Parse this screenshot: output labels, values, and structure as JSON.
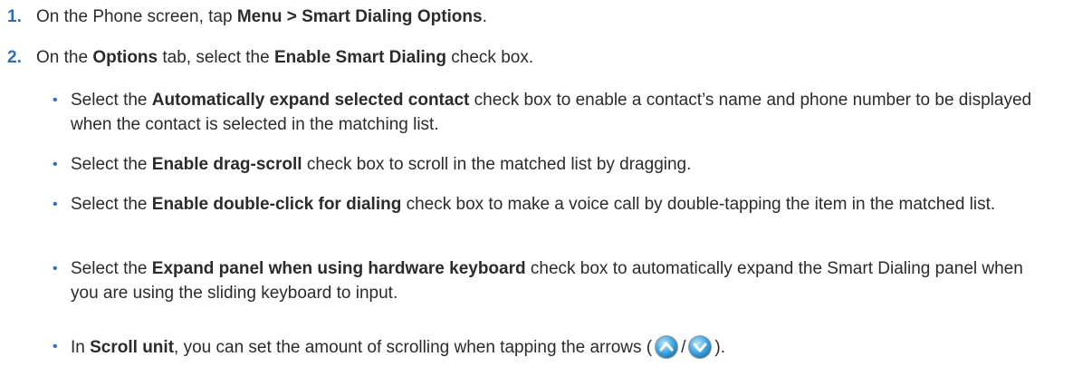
{
  "steps": [
    {
      "number": "1.",
      "pre": "On the Phone screen, tap ",
      "bold": "Menu > Smart Dialing Options",
      "post": "."
    },
    {
      "number": "2.",
      "pre": "On the ",
      "bold1": "Options",
      "mid": " tab, select the ",
      "bold2": "Enable Smart Dialing",
      "post": " check box."
    }
  ],
  "bullets": [
    {
      "pre": "Select the ",
      "bold": "Automatically expand selected contact",
      "post": " check box to enable a contact’s name and phone number to be displayed when the contact is selected in the matching list."
    },
    {
      "pre": "Select the ",
      "bold": "Enable drag-scroll",
      "post": " check box to scroll in the matched list by dragging."
    },
    {
      "pre": "Select the ",
      "bold": "Enable double-click for dialing",
      "post": " check box to make a voice call by double-tapping the item in the matched list."
    },
    {
      "pre": "Select the ",
      "bold": "Expand panel when using hardware keyboard",
      "post": " check box to automatically expand the Smart Dialing panel when you are using the sliding keyboard to input."
    },
    {
      "pre": "In ",
      "bold": "Scroll unit",
      "post": ", you can set the amount of scrolling when tapping the arrows (",
      "separator": "/",
      "end": ")."
    }
  ],
  "bullet_glyph": "•",
  "icons": {
    "up": "scroll-up-arrow-icon",
    "down": "scroll-down-arrow-icon"
  },
  "colors": {
    "accent": "#2f6fb3",
    "text": "#2b2b2b",
    "icon_fill": "#3ba3e0"
  }
}
